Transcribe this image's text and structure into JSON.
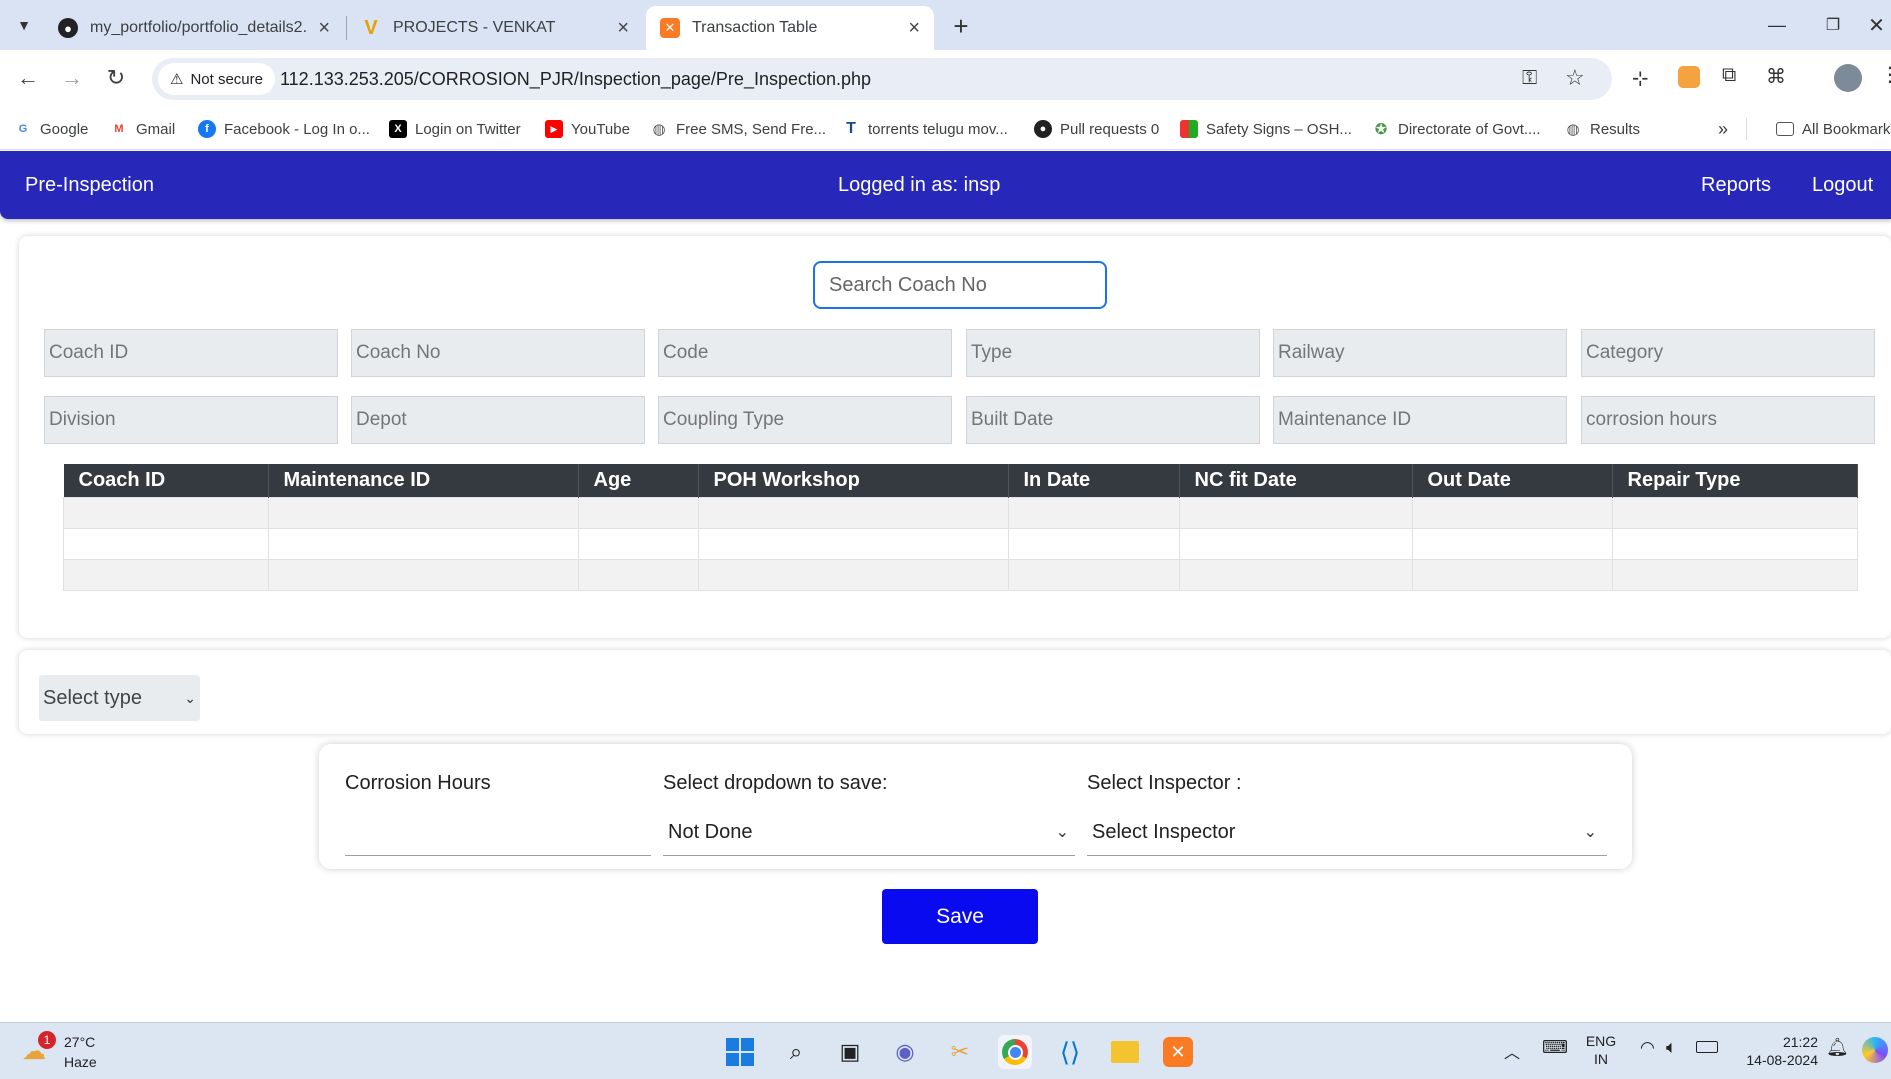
{
  "browser": {
    "tabs": [
      {
        "title": "my_portfolio/portfolio_details2.",
        "icon": "github-icon"
      },
      {
        "title": "PROJECTS - VENKAT",
        "icon": "v-logo-icon"
      },
      {
        "title": "Transaction Table",
        "icon": "xampp-icon",
        "active": true
      }
    ],
    "not_secure": "Not secure",
    "url": "112.133.253.205/CORROSION_PJR/Inspection_page/Pre_Inspection.php",
    "bookmarks": [
      "Google",
      "Gmail",
      "Facebook - Log In o...",
      "Login on Twitter",
      "YouTube",
      "Free SMS, Send Fre...",
      "torrents telugu mov...",
      "Pull requests 0",
      "Safety Signs – OSH...",
      "Directorate of Govt....",
      "Results"
    ],
    "more_bookmarks": "»",
    "all_bookmarks": "All Bookmarks"
  },
  "app": {
    "brand": "Pre-Inspection",
    "logged_in": "Logged in as: insp",
    "nav": {
      "reports": "Reports",
      "logout": "Logout"
    },
    "search_placeholder": "Search Coach No",
    "fields_row1": [
      "Coach ID",
      "Coach No",
      "Code",
      "Type",
      "Railway",
      "Category"
    ],
    "fields_row2": [
      "Division",
      "Depot",
      "Coupling Type",
      "Built Date",
      "Maintenance ID",
      "corrosion hours"
    ],
    "table": {
      "headers": [
        "Coach ID",
        "Maintenance ID",
        "Age",
        "POH Workshop",
        "In Date",
        "NC fit Date",
        "Out Date",
        "Repair Type"
      ]
    },
    "select_type": "Select type",
    "form": {
      "corrosion_label": "Corrosion Hours",
      "dropdown_label": "Select dropdown to save:",
      "dropdown_value": "Not Done",
      "inspector_label": "Select Inspector :",
      "inspector_value": "Select Inspector"
    },
    "save": "Save"
  },
  "taskbar": {
    "weather_temp": "27°C",
    "weather_desc": "Haze",
    "weather_badge": "1",
    "lang": "ENG",
    "region": "IN",
    "time": "21:22",
    "date": "14-08-2024"
  }
}
